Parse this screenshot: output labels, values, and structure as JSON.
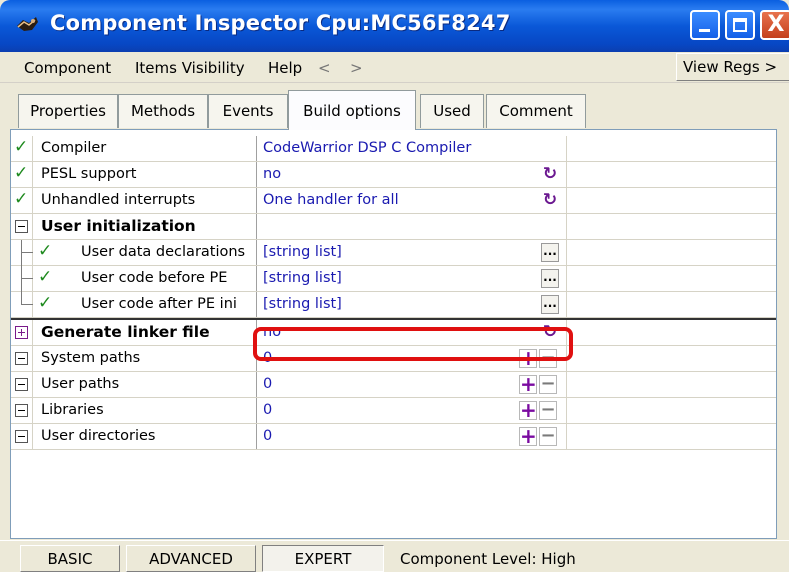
{
  "window": {
    "title": "Component Inspector Cpu:MC56F8247",
    "minimize_glyph": "",
    "close_glyph": "X"
  },
  "menu": {
    "items": [
      "Component",
      "Items Visibility",
      "Help"
    ],
    "back_arrow": "<",
    "forward_arrow": ">",
    "view_regs_label": "View Regs >"
  },
  "tabs": [
    {
      "label": "Properties",
      "active": false
    },
    {
      "label": "Methods",
      "active": false
    },
    {
      "label": "Events",
      "active": false
    },
    {
      "label": "Build options",
      "active": true
    },
    {
      "label": "Used",
      "active": false
    },
    {
      "label": "Comment",
      "active": false
    }
  ],
  "rows": [
    {
      "name": "Compiler",
      "value": "CodeWarrior DSP C Compiler",
      "icon": "check-icon",
      "button": ""
    },
    {
      "name": "PESL support",
      "value": "no",
      "icon": "check-icon",
      "button": "cycle-icon"
    },
    {
      "name": "Unhandled interrupts",
      "value": "One handler for all",
      "icon": "check-icon",
      "button": "cycle-icon"
    },
    {
      "name": "User initialization",
      "value": "",
      "icon": "collapse-icon",
      "button": ""
    },
    {
      "name": "User data declarations",
      "value": "[string list]",
      "icon": "check-icon",
      "button": "ellipsis-icon"
    },
    {
      "name": "User code before PE",
      "value": "[string list]",
      "icon": "check-icon",
      "button": "ellipsis-icon"
    },
    {
      "name": "User code after PE ini",
      "value": "[string list]",
      "icon": "check-icon",
      "button": "ellipsis-icon"
    },
    {
      "name": "Generate linker file",
      "value": "no",
      "icon": "expand-icon",
      "button": "cycle-icon"
    },
    {
      "name": "System paths",
      "value": "0",
      "icon": "collapse-icon",
      "button": "plus-minus"
    },
    {
      "name": "User paths",
      "value": "0",
      "icon": "collapse-icon",
      "button": "plus-minus"
    },
    {
      "name": "Libraries",
      "value": "0",
      "icon": "collapse-icon",
      "button": "plus-minus"
    },
    {
      "name": "User directories",
      "value": "0",
      "icon": "collapse-icon",
      "button": "plus-minus"
    }
  ],
  "level": {
    "basic": "BASIC",
    "advanced": "ADVANCED",
    "expert": "EXPERT",
    "status": "Component Level: High"
  },
  "colors": {
    "title_bar": "#0a58d8",
    "value_text": "#1a1ab0",
    "check": "#1e8a1e",
    "highlight": "#e01010",
    "accent_purple": "#7a0aa0"
  }
}
